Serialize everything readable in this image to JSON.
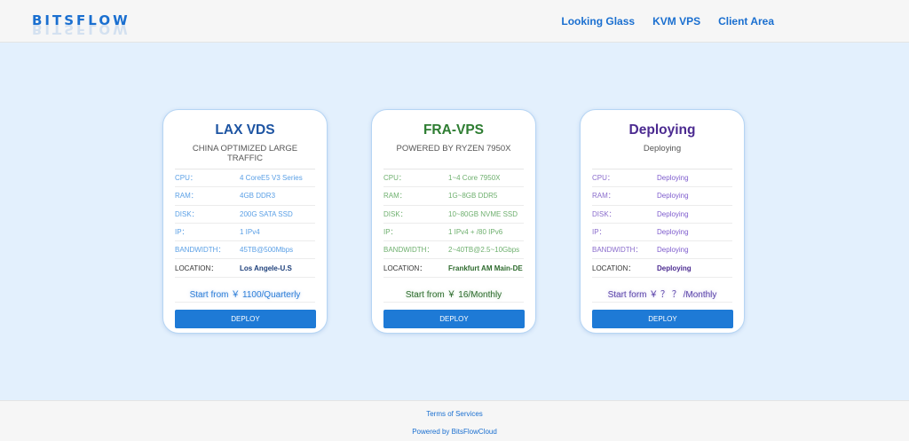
{
  "header": {
    "logo": "BITSFLOW",
    "nav": [
      {
        "label": "Looking Glass"
      },
      {
        "label": "KVM VPS"
      },
      {
        "label": "Client Area"
      }
    ]
  },
  "cards": [
    {
      "title": "LAX VDS",
      "subtitle": "CHINA OPTIMIZED LARGE TRAFFIC",
      "specs": [
        {
          "key": "CPU：",
          "value": "4 CoreE5 V3 Series"
        },
        {
          "key": "RAM：",
          "value": "4GB DDR3"
        },
        {
          "key": "DISK：",
          "value": "200G SATA SSD"
        },
        {
          "key": "IP：",
          "value": "1 IPv4"
        },
        {
          "key": "BANDWIDTH：",
          "value": "45TB@500Mbps"
        },
        {
          "key": "LOCATION：",
          "value": "Los Angele-U.S"
        }
      ],
      "price": "Start from ￥ 1100/Quarterly",
      "button": "DEPLOY"
    },
    {
      "title": "FRA-VPS",
      "subtitle": "POWERED BY RYZEN 7950X",
      "specs": [
        {
          "key": "CPU：",
          "value": "1~4 Core 7950X"
        },
        {
          "key": "RAM：",
          "value": "1G~8GB DDR5"
        },
        {
          "key": "DISK：",
          "value": "10~80GB NVME SSD"
        },
        {
          "key": "IP：",
          "value": "1 IPv4 + /80 IPv6"
        },
        {
          "key": "BANDWIDTH：",
          "value": "2~40TB@2.5~10Gbps"
        },
        {
          "key": "LOCATION：",
          "value": "Frankfurt AM Main-DE"
        }
      ],
      "price": "Start from ￥ 16/Monthly",
      "button": "DEPLOY"
    },
    {
      "title": "Deploying",
      "subtitle": "Deploying",
      "specs": [
        {
          "key": "CPU：",
          "value": "Deploying"
        },
        {
          "key": "RAM：",
          "value": "Deploying"
        },
        {
          "key": "DISK：",
          "value": "Deploying"
        },
        {
          "key": "IP：",
          "value": "Deploying"
        },
        {
          "key": "BANDWIDTH：",
          "value": "Deploying"
        },
        {
          "key": "LOCATION：",
          "value": "Deploying"
        }
      ],
      "price": "Start form ￥ ？ ？ /Monthly",
      "button": "DEPLOY"
    }
  ],
  "footer": {
    "terms": "Terms of Services",
    "powered": "Powered by BitsFlowCloud"
  }
}
